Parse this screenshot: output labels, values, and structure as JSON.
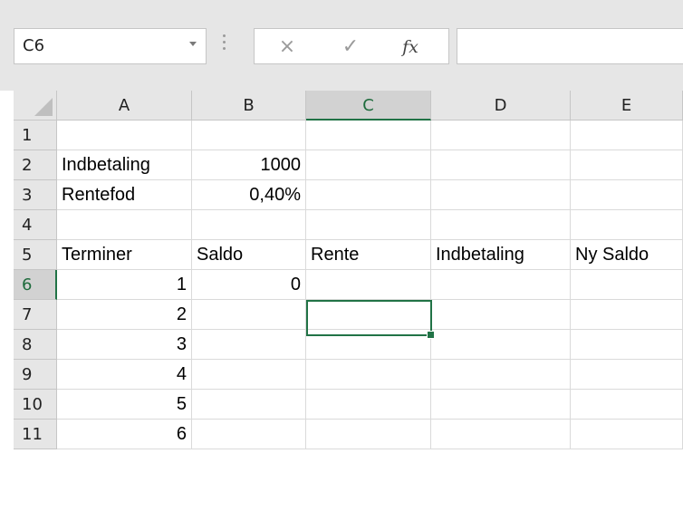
{
  "formula_bar": {
    "name_box": "C6",
    "cancel_icon": "×",
    "enter_icon": "✓",
    "fx_label": "fx",
    "formula_value": ""
  },
  "columns": [
    "A",
    "B",
    "C",
    "D",
    "E"
  ],
  "active_column": "C",
  "rows": [
    "1",
    "2",
    "3",
    "4",
    "5",
    "6",
    "7",
    "8",
    "9",
    "10",
    "11"
  ],
  "active_row": "6",
  "cells": {
    "A2": "Indbetaling",
    "B2": "1000",
    "A3": "Rentefod",
    "B3": "0,40%",
    "A5": "Terminer",
    "B5": "Saldo",
    "C5": "Rente",
    "D5": "Indbetaling",
    "E5": "Ny Saldo",
    "A6": "1",
    "B6": "0",
    "A7": "2",
    "A8": "3",
    "A9": "4",
    "A10": "5",
    "A11": "6"
  },
  "selected_cell": "C6",
  "colors": {
    "accent": "#217346",
    "header_bg": "#e6e6e6",
    "header_active_bg": "#d2d2d2",
    "gridline": "#dadada"
  }
}
